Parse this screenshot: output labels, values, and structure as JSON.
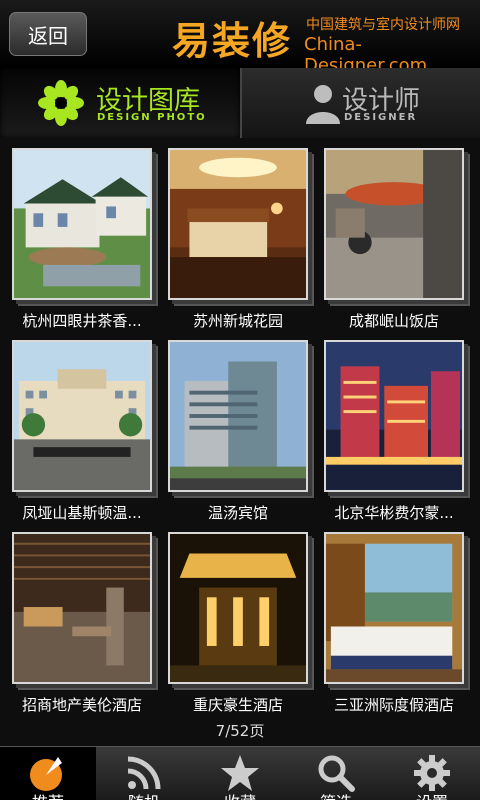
{
  "header": {
    "back_label": "返回",
    "brand_logo": "易装修",
    "brand_cn": "中国建筑与室内设计师网",
    "brand_en": "China-Designer.com"
  },
  "tabs": [
    {
      "label": "设计图库",
      "sub": "DESIGN PHOTO",
      "icon": "flower-icon",
      "active": true
    },
    {
      "label": "设计师",
      "sub": "DESIGNER",
      "icon": "person-icon",
      "active": false
    }
  ],
  "gallery": {
    "items": [
      {
        "title": "杭州四眼井茶香..."
      },
      {
        "title": "苏州新城花园"
      },
      {
        "title": "成都岷山饭店"
      },
      {
        "title": "凤垭山基斯顿温..."
      },
      {
        "title": "温汤宾馆"
      },
      {
        "title": "北京华彬费尔蒙..."
      },
      {
        "title": "招商地产美伦酒店"
      },
      {
        "title": "重庆豪生酒店"
      },
      {
        "title": "三亚洲际度假酒店"
      }
    ],
    "page_indicator": "7/52页"
  },
  "bottom_nav": [
    {
      "label": "推荐",
      "icon": "recommend-icon",
      "active": true
    },
    {
      "label": "随机",
      "icon": "rss-icon",
      "active": false
    },
    {
      "label": "收藏",
      "icon": "star-icon",
      "active": false
    },
    {
      "label": "筛选",
      "icon": "search-icon",
      "active": false
    },
    {
      "label": "设置",
      "icon": "gear-icon",
      "active": false
    }
  ],
  "colors": {
    "accent_orange": "#f5a623",
    "active_tab_green": "#a8e620"
  }
}
